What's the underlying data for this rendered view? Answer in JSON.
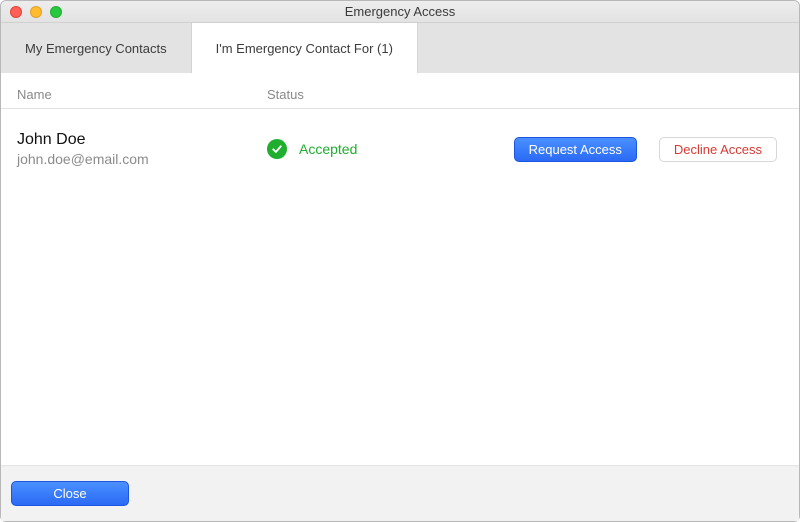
{
  "window": {
    "title": "Emergency Access"
  },
  "tabs": {
    "contacts_label": "My Emergency Contacts",
    "contact_for_label": "I'm Emergency Contact For (1)"
  },
  "columns": {
    "name": "Name",
    "status": "Status"
  },
  "entries": [
    {
      "name": "John Doe",
      "email": "john.doe@email.com",
      "status_label": "Accepted",
      "request_label": "Request Access",
      "decline_label": "Decline Access"
    }
  ],
  "footer": {
    "close_label": "Close"
  },
  "colors": {
    "accent_blue": "#2a6af6",
    "status_green": "#1fae2e",
    "danger_red": "#d93a34"
  }
}
